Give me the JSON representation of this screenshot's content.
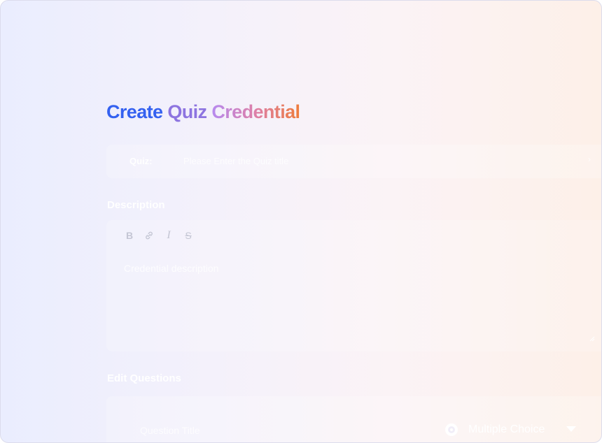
{
  "page": {
    "title_parts": [
      "Create",
      "Quiz",
      "Credential"
    ]
  },
  "quiz": {
    "label": "Quiz:",
    "placeholder": "Please Enter the Quiz title",
    "caret": "›"
  },
  "description": {
    "label": "Description",
    "toolbar": {
      "bold": "B",
      "link": "link-icon",
      "italic": "I",
      "strike": "S"
    },
    "placeholder": "Credential description"
  },
  "edit_questions": {
    "label": "Edit Questions",
    "question": {
      "title_placeholder": "Question Title",
      "type": "Multiple Choice"
    }
  },
  "colors": {
    "accent_blue": "#3461f0",
    "accent_purple": "#8d74e0",
    "accent_orange": "#ee7c3c"
  }
}
